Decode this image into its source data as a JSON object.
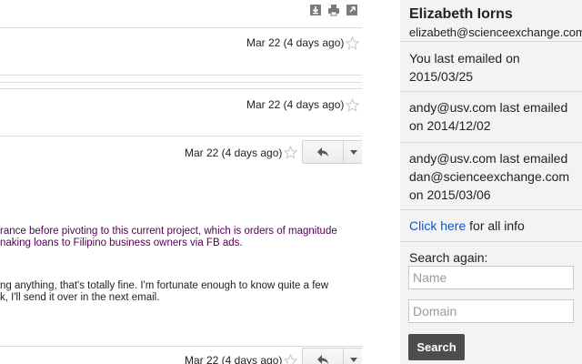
{
  "thread": {
    "messages": [
      {
        "date": "Mar 22 (4 days ago)"
      },
      {
        "date": "Mar 22 (4 days ago)"
      },
      {
        "date": "Mar 22 (4 days ago)"
      },
      {
        "date": "Mar 22 (4 days ago)"
      }
    ],
    "body_lines": [
      "rance before pivoting to this current project, which is orders of magnitude",
      "naking loans to Filipino business owners via FB ads.",
      "ng anything, that's totally fine. I'm fortunate enough to know quite a few",
      "k, I'll send it over in the next email."
    ]
  },
  "sidebar": {
    "name": "Elizabeth Iorns",
    "email": "elizabeth@scienceexchange.com",
    "last_emailed": [
      "You last emailed on",
      "2015/03/25"
    ],
    "andy_block": [
      "andy@usv.com last emailed",
      "on 2014/12/02"
    ],
    "dan_block": [
      "andy@usv.com last emailed",
      "dan@scienceexchange.com",
      "on 2015/03/06"
    ],
    "click_here": "Click here",
    "for_all_info": " for all info",
    "search_label": "Search again:",
    "name_placeholder": "Name",
    "domain_placeholder": "Domain",
    "search_button": "Search"
  }
}
